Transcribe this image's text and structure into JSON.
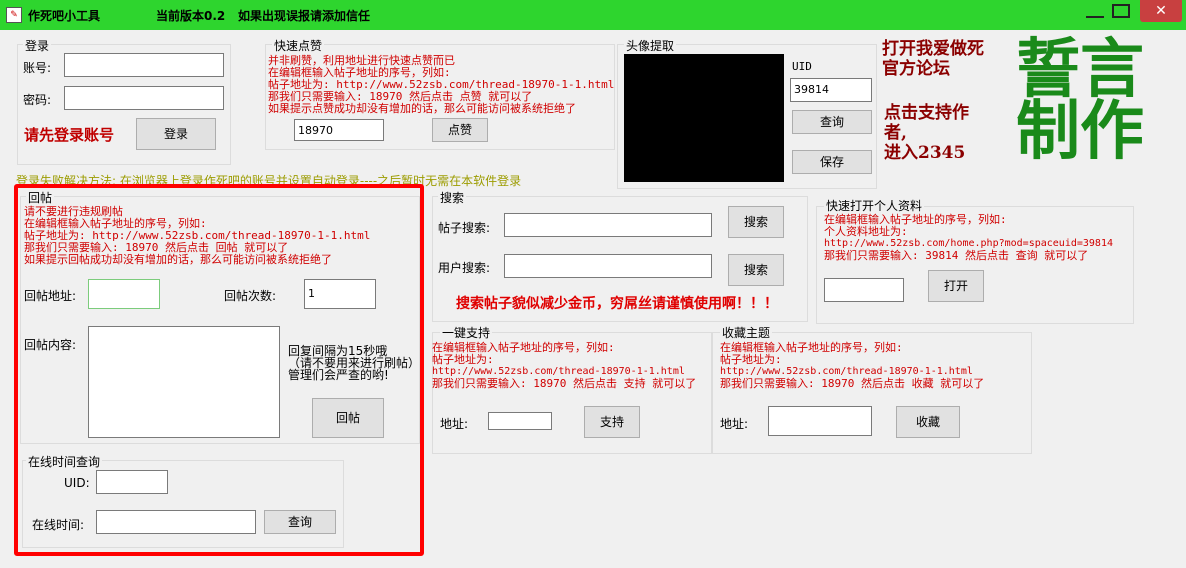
{
  "window": {
    "title": "作死吧小工具",
    "version": "当前版本0.2",
    "notice": "如果出现误报请添加信任",
    "close_glyph": "✕"
  },
  "login": {
    "group": "登录",
    "account_label": "账号:",
    "password_label": "密码:",
    "account_value": "",
    "password_value": "",
    "status": "请先登录账号",
    "login_button": "登录"
  },
  "quick_like": {
    "group": "快速点赞",
    "lines": [
      "并非刷赞，利用地址进行快速点赞而已",
      "在编辑框输入帖子地址的序号，列如:",
      "帖子地址为: http://www.52zsb.com/thread-18970-1-1.html",
      "那我们只需要输入: 18970  然后点击 点赞 就可以了",
      "如果提示点赞成功却没有增加的话，那么可能访问被系统拒绝了"
    ],
    "input_value": "18970",
    "button": "点赞"
  },
  "avatar": {
    "group": "头像提取",
    "uid_label": "UID",
    "uid_value": "39814",
    "query_button": "查询",
    "save_button": "保存"
  },
  "promo": {
    "forum_line1": "打开我爱做死",
    "forum_line2": "官方论坛",
    "support_line1": "点击支持作",
    "support_line2": "者,",
    "support_line3": "进入2345",
    "big1": "誓言",
    "big2": "制作"
  },
  "login_fail_tip": "登录失败解决方法: 在浏览器上登录作死吧的账号并设置自动登录----之后暂时无需在本软件登录",
  "reply": {
    "group": "回帖",
    "lines": [
      "请不要进行违规刷帖",
      "在编辑框输入帖子地址的序号，列如:",
      "帖子地址为: http://www.52zsb.com/thread-18970-1-1.html",
      "那我们只需要输入: 18970  然后点击 回帖 就可以了",
      "如果提示回帖成功却没有增加的话，那么可能访问被系统拒绝了"
    ],
    "address_label": "回帖地址:",
    "address_value": "",
    "count_label": "回帖次数:",
    "count_value": "1",
    "content_label": "回帖内容:",
    "content_value": "",
    "note_line1": "回复间隔为15秒哦",
    "note_line2": "（请不要用来进行刷帖）",
    "note_line3": "管理们会严查的哟!",
    "button": "回帖"
  },
  "online": {
    "group": "在线时间查询",
    "uid_label": "UID:",
    "uid_value": "",
    "time_label": "在线时间:",
    "time_value": "",
    "button": "查询"
  },
  "search": {
    "group": "搜索",
    "post_label": "帖子搜索:",
    "post_value": "",
    "post_button": "搜索",
    "user_label": "用户搜索:",
    "user_value": "",
    "user_button": "搜索",
    "warning": "搜索帖子貌似减少金币，穷屌丝请谨慎使用啊！！！"
  },
  "profile": {
    "group": "快速打开个人资料",
    "lines": [
      "在编辑框输入帖子地址的序号，列如:",
      "个人资料地址为:",
      "http://www.52zsb.com/home.php?mod=spaceuid=39814",
      "那我们只需要输入: 39814  然后点击 查询 就可以了"
    ],
    "input_value": "",
    "button": "打开"
  },
  "support": {
    "group": "一键支持",
    "lines": [
      "在编辑框输入帖子地址的序号，列如:",
      "帖子地址为:",
      "http://www.52zsb.com/thread-18970-1-1.html",
      "那我们只需要输入: 18970  然后点击 支持 就可以了"
    ],
    "address_label": "地址:",
    "address_value": "",
    "button": "支持"
  },
  "collect": {
    "group": "收藏主题",
    "lines": [
      "在编辑框输入帖子地址的序号，列如:",
      "帖子地址为:",
      "http://www.52zsb.com/thread-18970-1-1.html",
      "那我们只需要输入: 18970  然后点击 收藏 就可以了"
    ],
    "address_label": "地址:",
    "address_value": "",
    "button": "收藏"
  }
}
